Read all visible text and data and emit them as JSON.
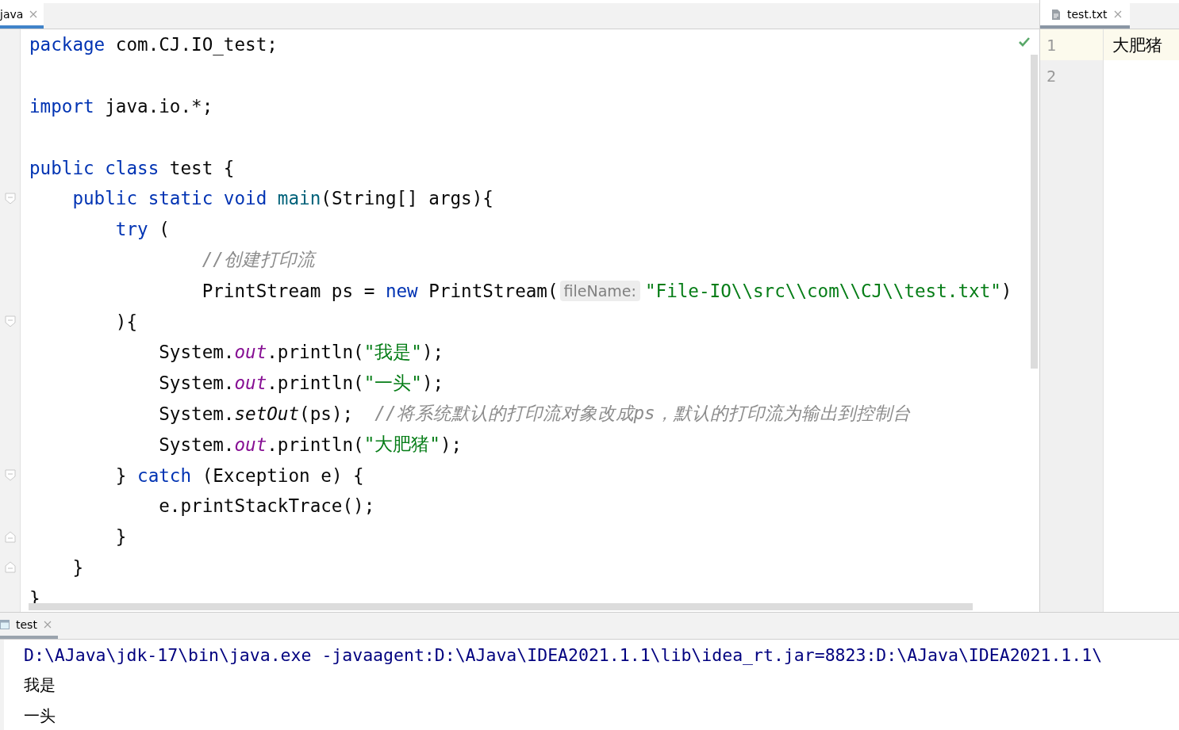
{
  "editor_tabs": [
    {
      "label": "java",
      "selected": true
    }
  ],
  "code_lines": [
    {
      "fold_start": false,
      "fold_end": false,
      "tokens": [
        {
          "kind": "keyword",
          "text": "package"
        },
        {
          "kind": "text",
          "text": " com.CJ.IO_test;"
        }
      ]
    },
    {
      "fold_start": false,
      "fold_end": false
    },
    {
      "fold_start": false,
      "fold_end": false,
      "tokens": [
        {
          "kind": "keyword",
          "text": "import"
        },
        {
          "kind": "text",
          "text": " java.io.*;"
        }
      ]
    },
    {
      "fold_start": false,
      "fold_end": false
    },
    {
      "fold_start": false,
      "fold_end": false,
      "tokens": [
        {
          "kind": "keyword",
          "text": "public class"
        },
        {
          "kind": "text",
          "text": " test {"
        }
      ]
    },
    {
      "fold_start": true,
      "fold_end": false,
      "tokens": [
        {
          "kind": "keyword",
          "text": "    public static void"
        },
        {
          "kind": "method",
          "text": " main"
        },
        {
          "kind": "text",
          "text": "(String[] args){"
        }
      ]
    },
    {
      "fold_start": false,
      "fold_end": false,
      "tokens": [
        {
          "kind": "keyword",
          "text": "        try"
        },
        {
          "kind": "text",
          "text": " ("
        }
      ]
    },
    {
      "fold_start": false,
      "fold_end": false,
      "tokens": [
        {
          "kind": "comment",
          "text": "                //创建打印流"
        }
      ]
    },
    {
      "fold_start": false,
      "fold_end": false,
      "tokens": [
        {
          "kind": "text",
          "text": "                PrintStream ps = "
        },
        {
          "kind": "keyword",
          "text": "new"
        },
        {
          "kind": "text",
          "text": " PrintStream("
        },
        {
          "kind": "hint",
          "text": "fileName:"
        },
        {
          "kind": "string",
          "text": "\"File-IO\\\\src\\\\com\\\\CJ\\\\test.txt\""
        },
        {
          "kind": "text",
          "text": ")"
        }
      ]
    },
    {
      "fold_start": true,
      "fold_end": false,
      "tokens": [
        {
          "kind": "text",
          "text": "        ){"
        }
      ]
    },
    {
      "fold_start": false,
      "fold_end": false,
      "tokens": [
        {
          "kind": "text",
          "text": "            System."
        },
        {
          "kind": "field",
          "text": "out"
        },
        {
          "kind": "text",
          "text": ".println("
        },
        {
          "kind": "string",
          "text": "\"我是\""
        },
        {
          "kind": "text",
          "text": ");"
        }
      ]
    },
    {
      "fold_start": false,
      "fold_end": false,
      "tokens": [
        {
          "kind": "text",
          "text": "            System."
        },
        {
          "kind": "field",
          "text": "out"
        },
        {
          "kind": "text",
          "text": ".println("
        },
        {
          "kind": "string",
          "text": "\"一头\""
        },
        {
          "kind": "text",
          "text": ");"
        }
      ]
    },
    {
      "fold_start": false,
      "fold_end": false,
      "tokens": [
        {
          "kind": "text",
          "text": "            System."
        },
        {
          "kind": "static",
          "text": "setOut"
        },
        {
          "kind": "text",
          "text": "(ps);  "
        },
        {
          "kind": "comment",
          "text": "//将系统默认的打印流对象改成ps，默认的打印流为输出到控制台"
        }
      ]
    },
    {
      "fold_start": false,
      "fold_end": false,
      "tokens": [
        {
          "kind": "text",
          "text": "            System."
        },
        {
          "kind": "field",
          "text": "out"
        },
        {
          "kind": "text",
          "text": ".println("
        },
        {
          "kind": "string",
          "text": "\"大肥猪\""
        },
        {
          "kind": "text",
          "text": ");"
        }
      ]
    },
    {
      "fold_start": true,
      "fold_end": false,
      "tokens": [
        {
          "kind": "text",
          "text": "        } "
        },
        {
          "kind": "keyword",
          "text": "catch"
        },
        {
          "kind": "text",
          "text": " (Exception e) {"
        }
      ]
    },
    {
      "fold_start": false,
      "fold_end": false,
      "tokens": [
        {
          "kind": "text",
          "text": "            e.printStackTrace();"
        }
      ]
    },
    {
      "fold_start": false,
      "fold_end": true,
      "tokens": [
        {
          "kind": "text",
          "text": "        }"
        }
      ]
    },
    {
      "fold_start": false,
      "fold_end": true,
      "tokens": [
        {
          "kind": "text",
          "text": "    }"
        }
      ]
    },
    {
      "fold_start": false,
      "fold_end": false,
      "tokens": [
        {
          "kind": "text",
          "text": "}"
        }
      ]
    }
  ],
  "side_tab": {
    "label": "test.txt",
    "selected": true
  },
  "side_lines": [
    {
      "number": "1",
      "text": "大肥猪",
      "current": true
    },
    {
      "number": "2",
      "current": false
    }
  ],
  "run_tab": {
    "label": "test",
    "selected": true
  },
  "console_lines": [
    {
      "kind": "command",
      "text": "D:\\AJava\\jdk-17\\bin\\java.exe -javaagent:D:\\AJava\\IDEA2021.1.1\\lib\\idea_rt.jar=8823:D:\\AJava\\IDEA2021.1.1\\"
    },
    {
      "kind": "output",
      "text": "我是"
    },
    {
      "kind": "output",
      "text": "一头"
    }
  ]
}
